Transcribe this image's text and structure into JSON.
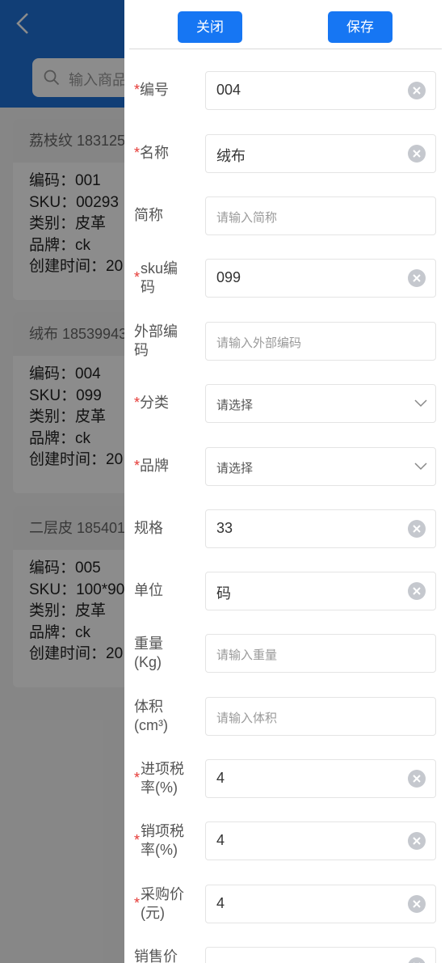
{
  "background": {
    "search_placeholder": "输入商品",
    "cards": [
      {
        "title": "荔枝纹 183125",
        "code": "编码：001",
        "sku": "SKU：00293",
        "category": "类别：皮革",
        "brand": "品牌：ck",
        "created": "创建时间：20"
      },
      {
        "title": "绒布 18539943",
        "code": "编码：004",
        "sku": "SKU：099",
        "category": "类别：皮革",
        "brand": "品牌：ck",
        "created": "创建时间：20"
      },
      {
        "title": "二层皮 185401",
        "code": "编码：005",
        "sku": "SKU：100*90",
        "category": "类别：皮革",
        "brand": "品牌：ck",
        "created": "创建时间：20"
      }
    ]
  },
  "drawer": {
    "close_label": "关闭",
    "save_label": "保存",
    "fields": {
      "code": {
        "label": "编号",
        "value": "004"
      },
      "name": {
        "label": "名称",
        "value": "绒布"
      },
      "short_name": {
        "label": "简称",
        "placeholder": "请输入简称"
      },
      "sku_code": {
        "label_l1": "sku编",
        "label_l2": "码",
        "value": "099"
      },
      "external_code": {
        "label_l1": "外部编",
        "label_l2": "码",
        "placeholder": "请输入外部编码"
      },
      "category": {
        "label": "分类",
        "placeholder": "请选择"
      },
      "brand": {
        "label": "品牌",
        "placeholder": "请选择"
      },
      "spec": {
        "label": "规格",
        "value": "33"
      },
      "unit": {
        "label": "单位",
        "value": "码"
      },
      "weight": {
        "label_l1": "重量",
        "label_l2": "(Kg)",
        "placeholder": "请输入重量"
      },
      "volume": {
        "label_l1": "体积",
        "label_l2": "(cm³)",
        "placeholder": "请输入体积"
      },
      "input_tax": {
        "label_l1": "进项税",
        "label_l2": "率(%)",
        "value": "4"
      },
      "output_tax": {
        "label_l1": "销项税",
        "label_l2": "率(%)",
        "value": "4"
      },
      "purchase_price": {
        "label_l1": "采购价",
        "label_l2": "(元)",
        "value": "4"
      },
      "sale_price": {
        "label_l1": "销售价"
      }
    },
    "required_mark": "*"
  }
}
